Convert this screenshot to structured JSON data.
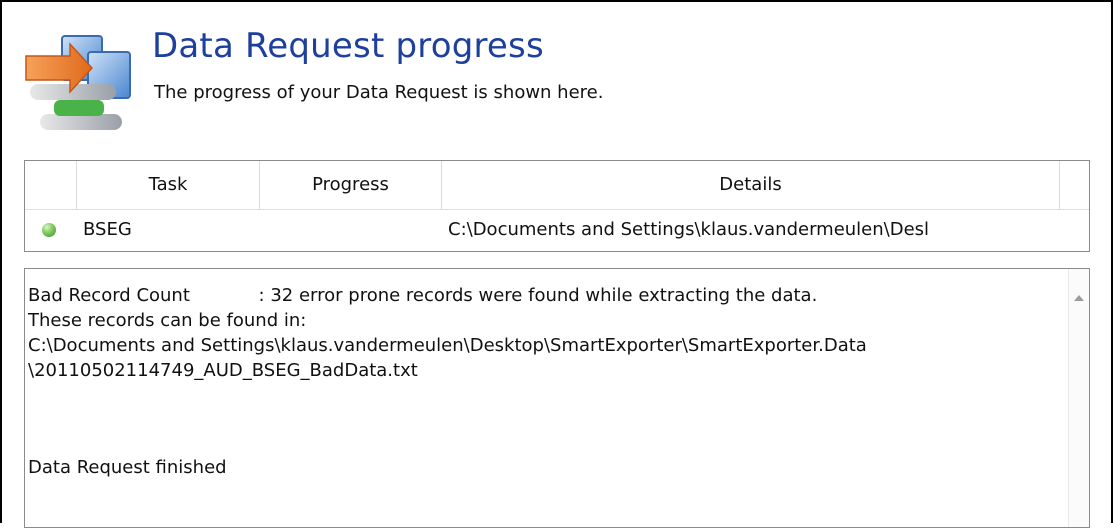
{
  "header": {
    "title": "Data Request progress",
    "subtitle": "The progress of your Data Request is shown here.",
    "icon": "network-transfer-icon"
  },
  "tasks": {
    "columns": [
      "",
      "Task",
      "Progress",
      "Details"
    ],
    "rows": [
      {
        "status": "completed",
        "status_color": "#5cb83c",
        "task": "BSEG",
        "progress": "",
        "details": "C:\\Documents and Settings\\klaus.vandermeulen\\Desl"
      }
    ]
  },
  "log": {
    "lines": [
      "Bad Record Count            : 32 error prone records were found while extracting the data.",
      "These records can be found in:",
      "C:\\Documents and Settings\\klaus.vandermeulen\\Desktop\\SmartExporter\\SmartExporter.Data",
      "\\20110502114749_AUD_BSEG_BadData.txt"
    ],
    "final": "Data Request finished"
  },
  "colors": {
    "title": "#1d3f9e",
    "border": "#8a8a8a"
  }
}
